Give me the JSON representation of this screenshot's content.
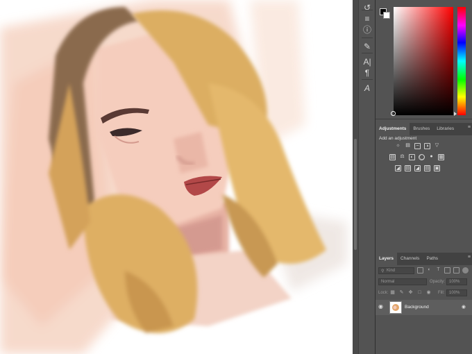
{
  "toolbar": {
    "tools": [
      "history-icon",
      "adjust-sliders-icon",
      "info-icon",
      "brush-icon",
      "character-icon",
      "paragraph-icon",
      "glyphs-icon"
    ]
  },
  "color_panel": {
    "foreground": "#000000",
    "background": "#ffffff",
    "hue": "#ff0000"
  },
  "adjustments_panel": {
    "tabs": [
      "Adjustments",
      "Brushes",
      "Libraries"
    ],
    "add_label": "Add an adjustment"
  },
  "layers_panel": {
    "tabs": [
      "Layers",
      "Channels",
      "Paths"
    ],
    "filter_kind": "Kind",
    "blend_mode": "Normal",
    "opacity_label": "Opacity:",
    "opacity_value": "100%",
    "lock_label": "Lock:",
    "fill_label": "Fill:",
    "fill_value": "100%",
    "layers": [
      {
        "name": "Background",
        "visible": true,
        "locked": true
      }
    ]
  }
}
